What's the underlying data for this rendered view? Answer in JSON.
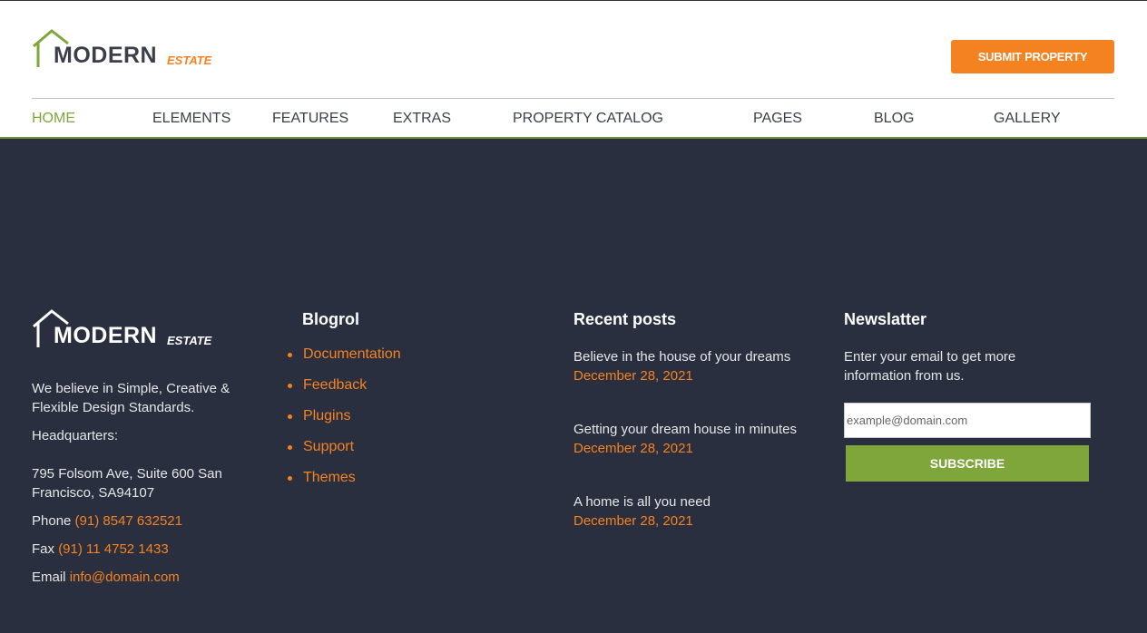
{
  "colors": {
    "accent": "#f58220",
    "brand_green": "#7ea63a",
    "footer_bg": "#2a2f3f"
  },
  "header": {
    "logo": {
      "main": "MODERN",
      "sub": "ESTATE"
    },
    "submit_label": "SUBMIT PROPERTY",
    "nav": [
      {
        "label": "HOME"
      },
      {
        "label": "ELEMENTS"
      },
      {
        "label": "FEATURES"
      },
      {
        "label": "EXTRAS"
      },
      {
        "label": "PROPERTY CATALOG"
      },
      {
        "label": "PAGES"
      },
      {
        "label": "BLOG"
      },
      {
        "label": "GALLERY"
      }
    ]
  },
  "footer": {
    "logo": {
      "main": "MODERN",
      "sub": "ESTATE"
    },
    "about": {
      "tagline": "We believe in Simple, Creative & Flexible Design Standards.",
      "hq_label": "Headquarters:",
      "address": "795 Folsom Ave, Suite 600 San Francisco, SA94107",
      "phone_label": "Phone",
      "phone": "(91) 8547 632521",
      "fax_label": "Fax",
      "fax": "(91) 11 4752 1433",
      "email_label": "Email",
      "email": "info@domain.com"
    },
    "blogroll": {
      "title": "Blogrol",
      "items": [
        "Documentation",
        "Feedback",
        "Plugins",
        "Support",
        "Themes"
      ]
    },
    "recent": {
      "title": "Recent posts",
      "posts": [
        {
          "title": "Believe in the house of your dreams",
          "date": "December 28, 2021"
        },
        {
          "title": "Getting your dream house in minutes",
          "date": "December 28, 2021"
        },
        {
          "title": "A home is all you need",
          "date": "December 28, 2021"
        }
      ]
    },
    "newsletter": {
      "title": "Newslatter",
      "text": "Enter your email to get more information from us.",
      "placeholder": "example@domain.com",
      "button": "SUBSCRIBE"
    }
  }
}
